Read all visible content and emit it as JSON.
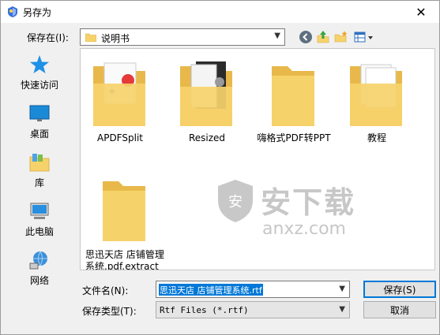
{
  "window": {
    "title": "另存为"
  },
  "savein": {
    "label": "保存在(I):",
    "value": "说明书"
  },
  "toolbar": {
    "icons": [
      "back-icon",
      "up-folder-icon",
      "new-folder-icon",
      "view-menu-icon"
    ]
  },
  "places": [
    {
      "label": "快速访问",
      "icon": "star-icon"
    },
    {
      "label": "桌面",
      "icon": "desktop-icon"
    },
    {
      "label": "库",
      "icon": "library-icon"
    },
    {
      "label": "此电脑",
      "icon": "computer-icon"
    },
    {
      "label": "网络",
      "icon": "network-icon"
    }
  ],
  "files": [
    {
      "name": "APDFSplit"
    },
    {
      "name": "Resized"
    },
    {
      "name": "嗨格式PDF转PPT"
    },
    {
      "name": "教程"
    },
    {
      "name": "思迅天店 店铺管理系统.pdf.extract"
    }
  ],
  "watermark": {
    "text": "安下载",
    "sub": "anxz.com"
  },
  "filename": {
    "label": "文件名(N):",
    "value": "思迅天店 店铺管理系统.rtf"
  },
  "filetype": {
    "label": "保存类型(T):",
    "value": "Rtf Files (*.rtf)"
  },
  "buttons": {
    "save": "保存(S)",
    "cancel": "取消"
  },
  "colors": {
    "accent": "#0078d7",
    "folder": "#f6d26b"
  }
}
